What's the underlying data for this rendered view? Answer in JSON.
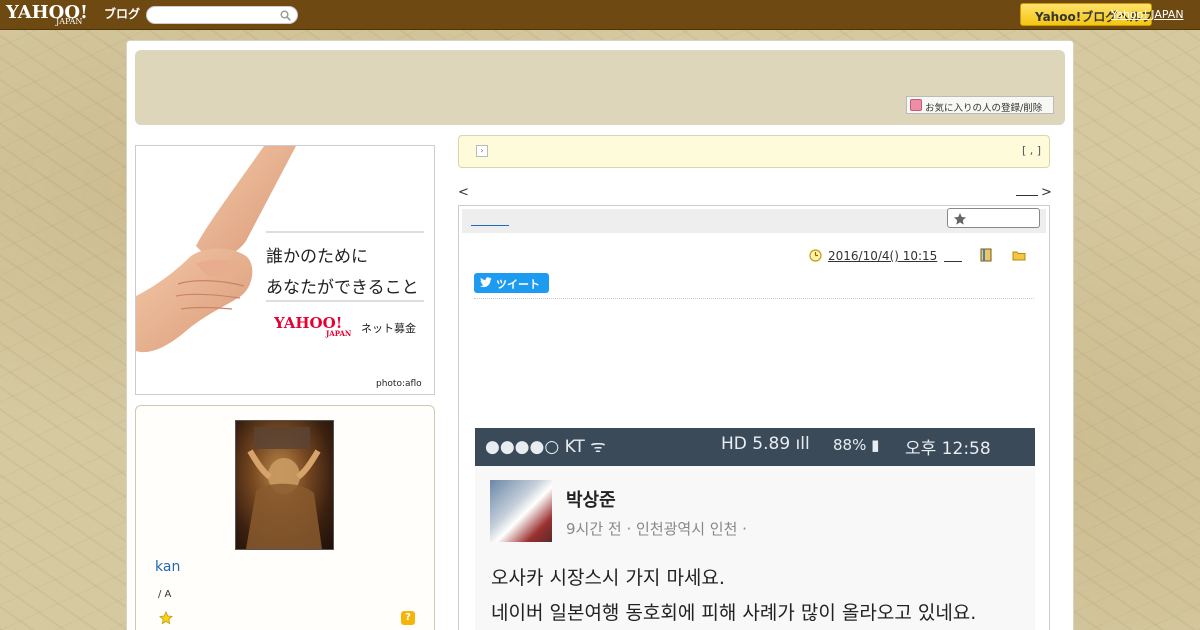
{
  "topbar": {
    "logo_main": "YAHOO!",
    "logo_sub": "JAPAN",
    "logo_blog": "ブログ",
    "search_placeholder": "",
    "yahoo_button": "Yahoo!ブログヘルプ",
    "yahoo_japan_link": "Yahoo! JAPAN"
  },
  "header": {
    "fav_register": "お気に入りの人の登録/削除"
  },
  "ad": {
    "line1": "誰かのために",
    "line2": "あなたができること",
    "logo": "YAHOO!",
    "logo_sub": "JAPAN",
    "donate": "ネット募金",
    "photo_credit": "photo:aflo"
  },
  "profile": {
    "name": "kan",
    "sub": "/ A",
    "help": "?"
  },
  "notice": {
    "icon": "›",
    "right": "[ , ]"
  },
  "nav": {
    "prev": "<",
    "next": ">"
  },
  "article": {
    "date": "2016/10/4()  10:15",
    "tweet": "ツイート"
  },
  "screenshot": {
    "status_left": "●●●●○ KT ᯤ",
    "status_mid": "HD 5.89 ıll",
    "status_battery": "88% ▮",
    "status_right": "오후 12:58",
    "poster_name": "박상준",
    "poster_meta": "9시간 전 · 인천광역시 인천 ·",
    "text1": "오사카 시장스시 가지 마세요.",
    "text2": "네이버 일본여행 동호회에 피해 사례가 많이 올라오고 있네요."
  },
  "colors": {
    "topbar": "#6e4a12",
    "header_bg": "#ddd6bb",
    "link": "#1e6ab8",
    "tweet": "#1d9bf0",
    "yahoo_button": "#f3c513"
  }
}
